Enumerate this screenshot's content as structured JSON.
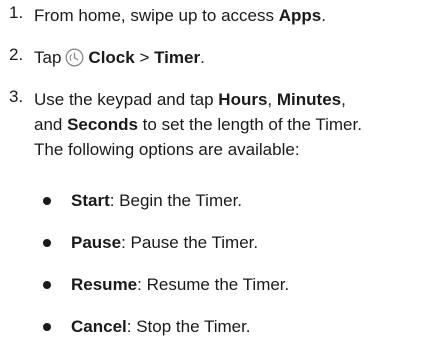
{
  "steps": [
    {
      "number": "1.",
      "prefix": "From home, swipe up to access ",
      "bold": "Apps",
      "suffix": "."
    },
    {
      "number": "2.",
      "prefix": "Tap",
      "icon": "clock-icon",
      "bold1": "Clock",
      "separator": " > ",
      "bold2": "Timer",
      "suffix": "."
    },
    {
      "number": "3.",
      "line1_prefix": "Use the keypad and tap ",
      "bold_hours": "Hours",
      "comma1": ", ",
      "bold_minutes": "Minutes",
      "comma2": ",",
      "line2_prefix": "and ",
      "bold_seconds": "Seconds",
      "line2_suffix": " to set the length of the Timer.",
      "line3": "The following options are available:"
    }
  ],
  "options": [
    {
      "label": "Start",
      "desc": ": Begin the Timer."
    },
    {
      "label": "Pause",
      "desc": ": Pause the Timer."
    },
    {
      "label": "Resume",
      "desc": ": Resume the Timer."
    },
    {
      "label": "Cancel",
      "desc": ": Stop the Timer."
    }
  ],
  "colors": {
    "text": "#1a1a1a",
    "icon_stroke": "#8a8a8a"
  }
}
